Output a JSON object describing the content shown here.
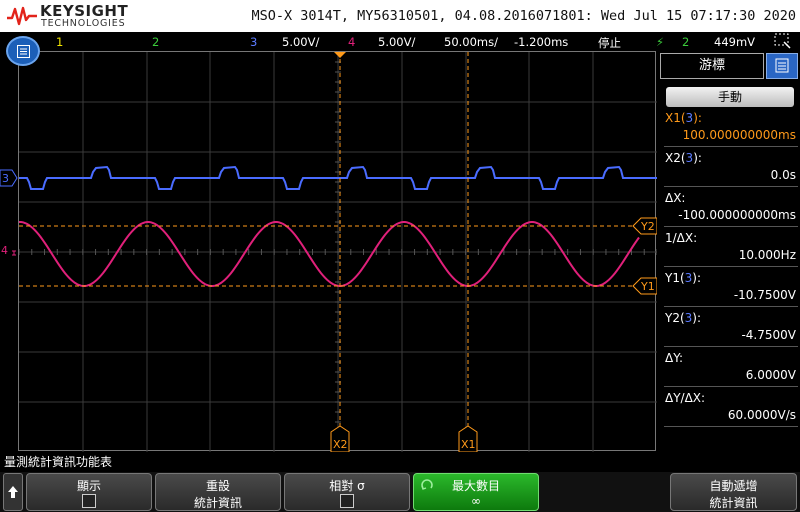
{
  "brand": {
    "name": "KEYSIGHT",
    "sub": "TECHNOLOGIES"
  },
  "instrument_info": "MSO-X 3014T, MY56310501, 04.08.2016071801: Wed Jul 15 07:17:30 2020",
  "channel_bar": {
    "ch1": "1",
    "ch2": "2",
    "ch3_num": "3",
    "ch3_scale": "5.00V/",
    "ch4_num": "4",
    "ch4_scale": "5.00V/",
    "timebase": "50.00ms/",
    "delay": "-1.200ms",
    "run_state": "停止",
    "trigger_source": "2",
    "trigger_level": "449mV"
  },
  "colors": {
    "ch1": "#f2e600",
    "ch2": "#3ccc3c",
    "ch3": "#4a6cff",
    "ch4": "#e0207a",
    "cursor": "#ff9a1a"
  },
  "waveform_labels": {
    "ch3_marker": "3",
    "ch4_marker": "4"
  },
  "cursors": {
    "x1_label": "X1",
    "x2_label": "X2",
    "y1_label": "Y1",
    "y2_label": "Y2"
  },
  "side_panel": {
    "tab_label": "游標",
    "mode_label": "手動",
    "x1_label": "X1(",
    "x1_src": "3",
    "x1_close": "):",
    "x1_value": "100.000000000ms",
    "x2_label": "X2(",
    "x2_src": "3",
    "x2_close": "):",
    "x2_value": "0.0s",
    "dx_label": "ΔX:",
    "dx_value": "-100.000000000ms",
    "inv_dx_label": "1/ΔX:",
    "inv_dx_value": "10.000Hz",
    "y1_label": "Y1(",
    "y1_src": "3",
    "y1_close": "):",
    "y1_value": "-10.7500V",
    "y2_label": "Y2(",
    "y2_src": "3",
    "y2_close": "):",
    "y2_value": "-4.7500V",
    "dy_label": "ΔY:",
    "dy_value": "6.0000V",
    "dydx_label": "ΔY/ΔX:",
    "dydx_value": "60.0000V/s"
  },
  "bottom": {
    "title": "量測統計資訊功能表",
    "display_l1": "顯示",
    "reset_l1": "重設",
    "reset_l2": "統計資訊",
    "relative_l1": "相對 σ",
    "max_count_l1": "最大數目",
    "max_count_l2": "∞",
    "transient_l1": "自動遞增",
    "transient_l2": "統計資訊"
  }
}
